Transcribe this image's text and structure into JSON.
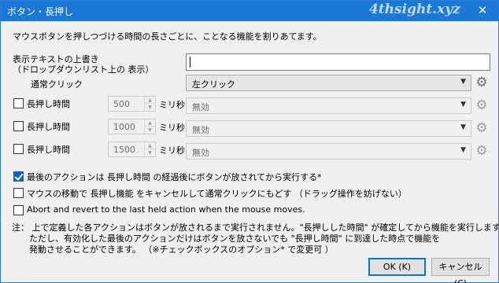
{
  "window": {
    "title": "ボタン・長押し",
    "watermark": "4thsight.xyz",
    "close_glyph": "✕"
  },
  "description": "マウスボタンを押しつづける時間の長さごとに、ことなる機能を割りあてます。",
  "override": {
    "label_line1": "表示テキストの上書き",
    "label_line2": "（ドロップダウンリスト上の 表示）",
    "value": ""
  },
  "normal_click": {
    "label": "通常クリック",
    "selected": "左クリック"
  },
  "long_presses": [
    {
      "label": "長押し時間",
      "checked": false,
      "ms": "500",
      "unit": "ミリ秒",
      "selected": "無効"
    },
    {
      "label": "長押し時間",
      "checked": false,
      "ms": "1000",
      "unit": "ミリ秒",
      "selected": "無効"
    },
    {
      "label": "長押し時間",
      "checked": false,
      "ms": "1500",
      "unit": "ミリ秒",
      "selected": "無効"
    }
  ],
  "options": [
    {
      "label": "最後のアクションは 長押し時間 の経過後にボタンが放されてから実行する*",
      "checked": true
    },
    {
      "label": "マウスの移動で 長押し機能 をキャンセルして通常クリックにもどす （ドラッグ操作を妨げない）",
      "checked": false
    },
    {
      "label": "Abort and revert to the last held action when the mouse moves.",
      "checked": false
    }
  ],
  "note": {
    "line1": "注： 上で定義した各アクションはボタンが放されるまで実行されません。\"長押しした時間\" が確定してから機能を実行します。",
    "line2": "ただし、有効化した最後のアクションだけはボタンを放さないでも \"長押し時間\" に到達した時点で機能を",
    "line3": "発動させることができます。 （※チェックボックスのオプション* で変更可 ）"
  },
  "buttons": {
    "ok": "OK (K)",
    "cancel": "キャンセル (C)"
  },
  "icons": {
    "gear": "gear-icon",
    "dropdown": "chevron-down-icon",
    "spin_up": "spin-up-icon",
    "spin_down": "spin-down-icon"
  },
  "colors": {
    "titlebar": "#1a78d6",
    "checkbox_checked": "#0a63c9",
    "default_button_border": "#0078d7"
  }
}
